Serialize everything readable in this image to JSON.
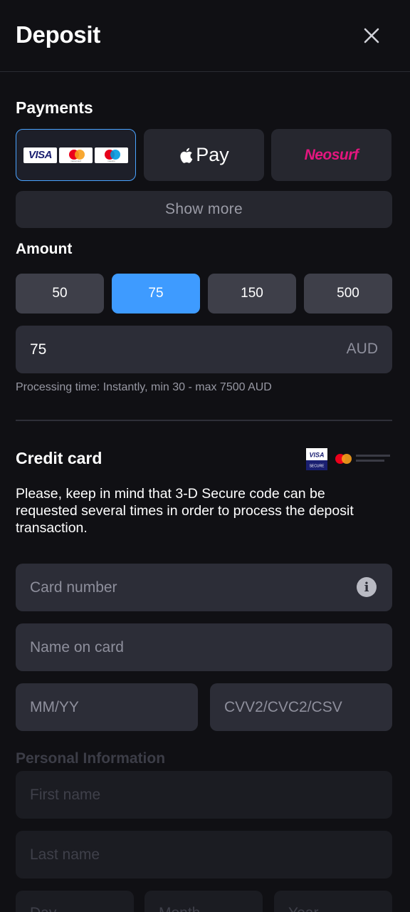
{
  "header": {
    "title": "Deposit"
  },
  "payments": {
    "title": "Payments",
    "methods": [
      {
        "name": "visa-mastercard-maestro",
        "logos": [
          "VISA",
          "mastercard",
          "maestro"
        ]
      },
      {
        "name": "apple-pay",
        "label": "Pay"
      },
      {
        "name": "neosurf",
        "label": "Neosurf"
      }
    ],
    "show_more_label": "Show more"
  },
  "amount": {
    "title": "Amount",
    "presets": [
      "50",
      "75",
      "150",
      "500"
    ],
    "selected": "75",
    "value": "75",
    "currency": "AUD",
    "processing_text": "Processing time: Instantly, min 30 - max 7500 AUD"
  },
  "credit_card": {
    "title": "Credit card",
    "badges": [
      "VISA",
      "SECURE"
    ],
    "notice": "Please, keep in mind that 3-D Secure code can be requested several times in order to process the deposit transaction.",
    "card_number_placeholder": "Card number",
    "name_placeholder": "Name on card",
    "expiry_placeholder": "MM/YY",
    "cvv_placeholder": "CVV2/CVC2/CSV"
  },
  "personal": {
    "title": "Personal Information",
    "first_name_placeholder": "First name",
    "last_name_placeholder": "Last name",
    "dob_placeholders": [
      "Day",
      "Month",
      "Year"
    ]
  },
  "colors": {
    "background": "#101014",
    "accent": "#3e9bff",
    "field": "#2c2d37",
    "neosurf": "#e4167f"
  }
}
